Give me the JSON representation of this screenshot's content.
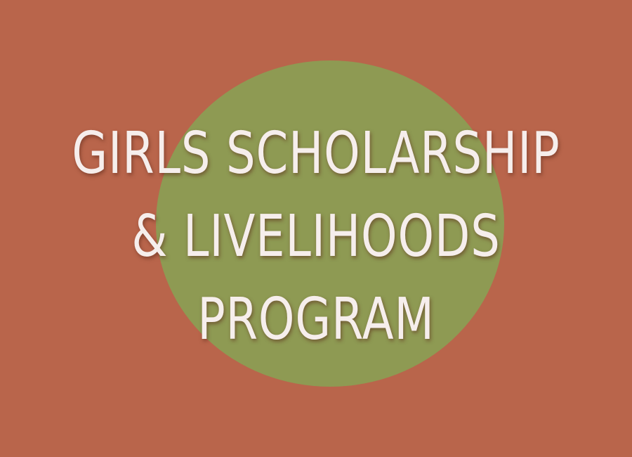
{
  "banner": {
    "title_lines": [
      "GIRLS SCHOLARSHIP",
      "& LIVELIHOODS",
      "PROGRAM"
    ],
    "colors": {
      "background": "#b9654b",
      "circle": "#8e9a53",
      "text": "#f6eeec"
    }
  }
}
